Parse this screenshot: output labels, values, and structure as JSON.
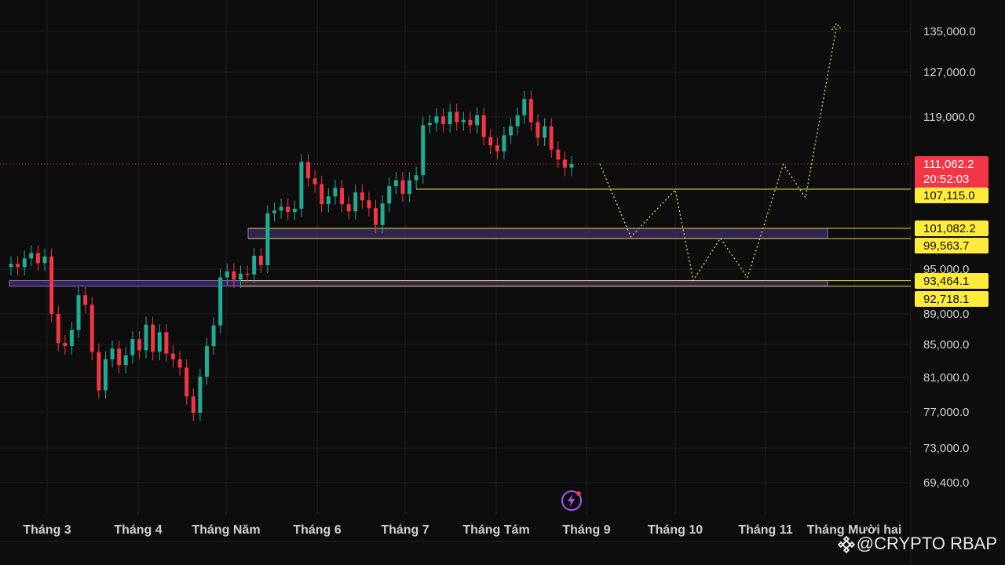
{
  "chart_data": {
    "type": "candlestick",
    "title": "",
    "ylim": [
      66000,
      138000
    ],
    "y_ticks": [
      "135,000.0",
      "127,000.0",
      "119,000.0",
      "95,000.0",
      "89,000.0",
      "85,000.0",
      "81,000.0",
      "77,000.0",
      "73,000.0",
      "69,400.0"
    ],
    "x_ticks": [
      "Tháng 3",
      "Tháng 4",
      "Tháng Năm",
      "Tháng 6",
      "Tháng 7",
      "Tháng Tám",
      "Tháng 9",
      "Tháng 10",
      "Tháng 11",
      "Tháng Mười hai"
    ],
    "current_price": {
      "value": 111062.2,
      "label": "111,062.2",
      "countdown": "20:52:03"
    },
    "levels": [
      {
        "value": 107115.0,
        "label": "107,115.0"
      },
      {
        "value": 101082.2,
        "label": "101,082.2"
      },
      {
        "value": 99563.7,
        "label": "99,563.7"
      },
      {
        "value": 93464.1,
        "label": "93,464.1"
      },
      {
        "value": 92718.1,
        "label": "92,718.1"
      }
    ],
    "zones": [
      {
        "name": "upper-zone",
        "from": 99563.7,
        "to": 101082.2,
        "start_month": "Tháng Năm"
      },
      {
        "name": "lower-zone",
        "from": 92718.1,
        "to": 93464.1,
        "start_month": "Tháng 3"
      }
    ],
    "candles_close": [
      95800,
      95300,
      96600,
      97400,
      95900,
      96900,
      89000,
      85200,
      84800,
      86900,
      91500,
      90200,
      84100,
      79500,
      83200,
      84500,
      82500,
      83700,
      85700,
      84300,
      87600,
      84100,
      86600,
      83900,
      83200,
      82200,
      78800,
      76900,
      81100,
      84800,
      87500,
      93900,
      94700,
      93600,
      94400,
      94300,
      97000,
      95600,
      103400,
      103800,
      104400,
      103600,
      104100,
      111400,
      108800,
      107900,
      104800,
      106000,
      107300,
      104800,
      103700,
      106600,
      105400,
      104200,
      101600,
      104900,
      107600,
      108500,
      106400,
      108500,
      109300,
      117600,
      118000,
      119100,
      117800,
      119900,
      118100,
      118500,
      117600,
      119300,
      115600,
      114200,
      113200,
      115900,
      117400,
      119300,
      122200,
      118100,
      115500,
      117400,
      113500,
      111800,
      110500,
      111062
    ],
    "projection_path": [
      {
        "month_pos": 6.15,
        "y": 111062
      },
      {
        "month_pos": 6.5,
        "y": 99800
      },
      {
        "month_pos": 7.0,
        "y": 107000
      },
      {
        "month_pos": 7.2,
        "y": 93500
      },
      {
        "month_pos": 7.5,
        "y": 99600
      },
      {
        "month_pos": 7.8,
        "y": 93900
      },
      {
        "month_pos": 8.2,
        "y": 111000
      },
      {
        "month_pos": 8.45,
        "y": 105800
      },
      {
        "month_pos": 8.8,
        "y": 135900
      }
    ],
    "colors": {
      "up": "#22ab94",
      "down": "#f23645",
      "level_line": "#e8d44d",
      "zone_fill": "#3b2a5e",
      "zone_border": "#8a6bd1",
      "price_tag": "#f23645",
      "level_tag": "#ffeb3b"
    }
  },
  "watermark": {
    "text": "@CRYPTO RBAP"
  },
  "icons": {
    "flash": "lightning-icon",
    "logo": "binance-diamond-icon"
  }
}
